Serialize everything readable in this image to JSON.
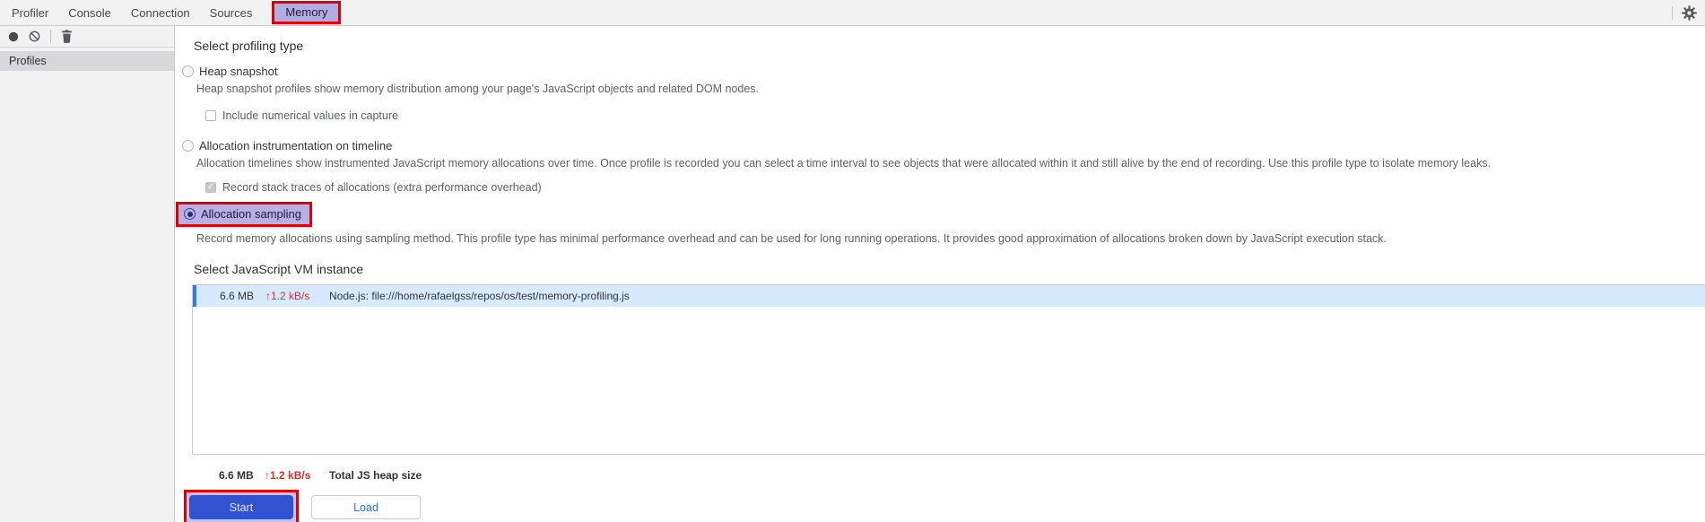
{
  "colors": {
    "annotation_red": "#de0004",
    "annotation_lavender": "#b6b0e5",
    "primary_button_blue": "#3153cf",
    "link_blue": "#1a73e8",
    "selected_row_blue": "#d7e9fc",
    "stat_red": "#d93025",
    "chrome_gray": "#f2f2f3"
  },
  "tabbar": {
    "tabs": [
      {
        "label": "Profiler",
        "selected": false
      },
      {
        "label": "Console",
        "selected": false
      },
      {
        "label": "Connection",
        "selected": false
      },
      {
        "label": "Sources",
        "selected": false
      },
      {
        "label": "Memory",
        "selected": true,
        "annotated": true
      }
    ],
    "gear_icon": "settings-gear"
  },
  "sidebar": {
    "toolbar_icons": [
      {
        "name": "record-icon"
      },
      {
        "name": "clear-icon"
      },
      {
        "name": "trash-icon"
      }
    ],
    "items": [
      {
        "label": "Profiles",
        "selected": true
      }
    ]
  },
  "main": {
    "profiling": {
      "heading": "Select profiling type",
      "options": [
        {
          "label": "Heap snapshot",
          "selected": false,
          "description": "Heap snapshot profiles show memory distribution among your page's JavaScript objects and related DOM nodes.",
          "checkbox": {
            "label": "Include numerical values in capture",
            "checked": false,
            "disabled": false
          }
        },
        {
          "label": "Allocation instrumentation on timeline",
          "selected": false,
          "description": "Allocation timelines show instrumented JavaScript memory allocations over time. Once profile is recorded you can select a time interval to see objects that were allocated within it and still alive by the end of recording. Use this profile type to isolate memory leaks.",
          "checkbox": {
            "label": "Record stack traces of allocations (extra performance overhead)",
            "checked": true,
            "disabled": true
          }
        },
        {
          "label": "Allocation sampling",
          "selected": true,
          "annotated": true,
          "description": "Record memory allocations using sampling method. This profile type has minimal performance overhead and can be used for long running operations. It provides good approximation of allocations broken down by JavaScript execution stack."
        }
      ]
    },
    "vm": {
      "heading": "Select JavaScript VM instance",
      "instances": [
        {
          "size": "6.6 MB",
          "rate": "↑1.2 kB/s",
          "name": "Node.js: file:///home/rafaelgss/repos/os/test/memory-profiling.js",
          "selected": true
        }
      ],
      "total": {
        "size": "6.6 MB",
        "rate": "↑1.2 kB/s",
        "label": "Total JS heap size"
      }
    },
    "actions": {
      "start_label": "Start",
      "load_label": "Load",
      "start_annotated": true
    }
  }
}
